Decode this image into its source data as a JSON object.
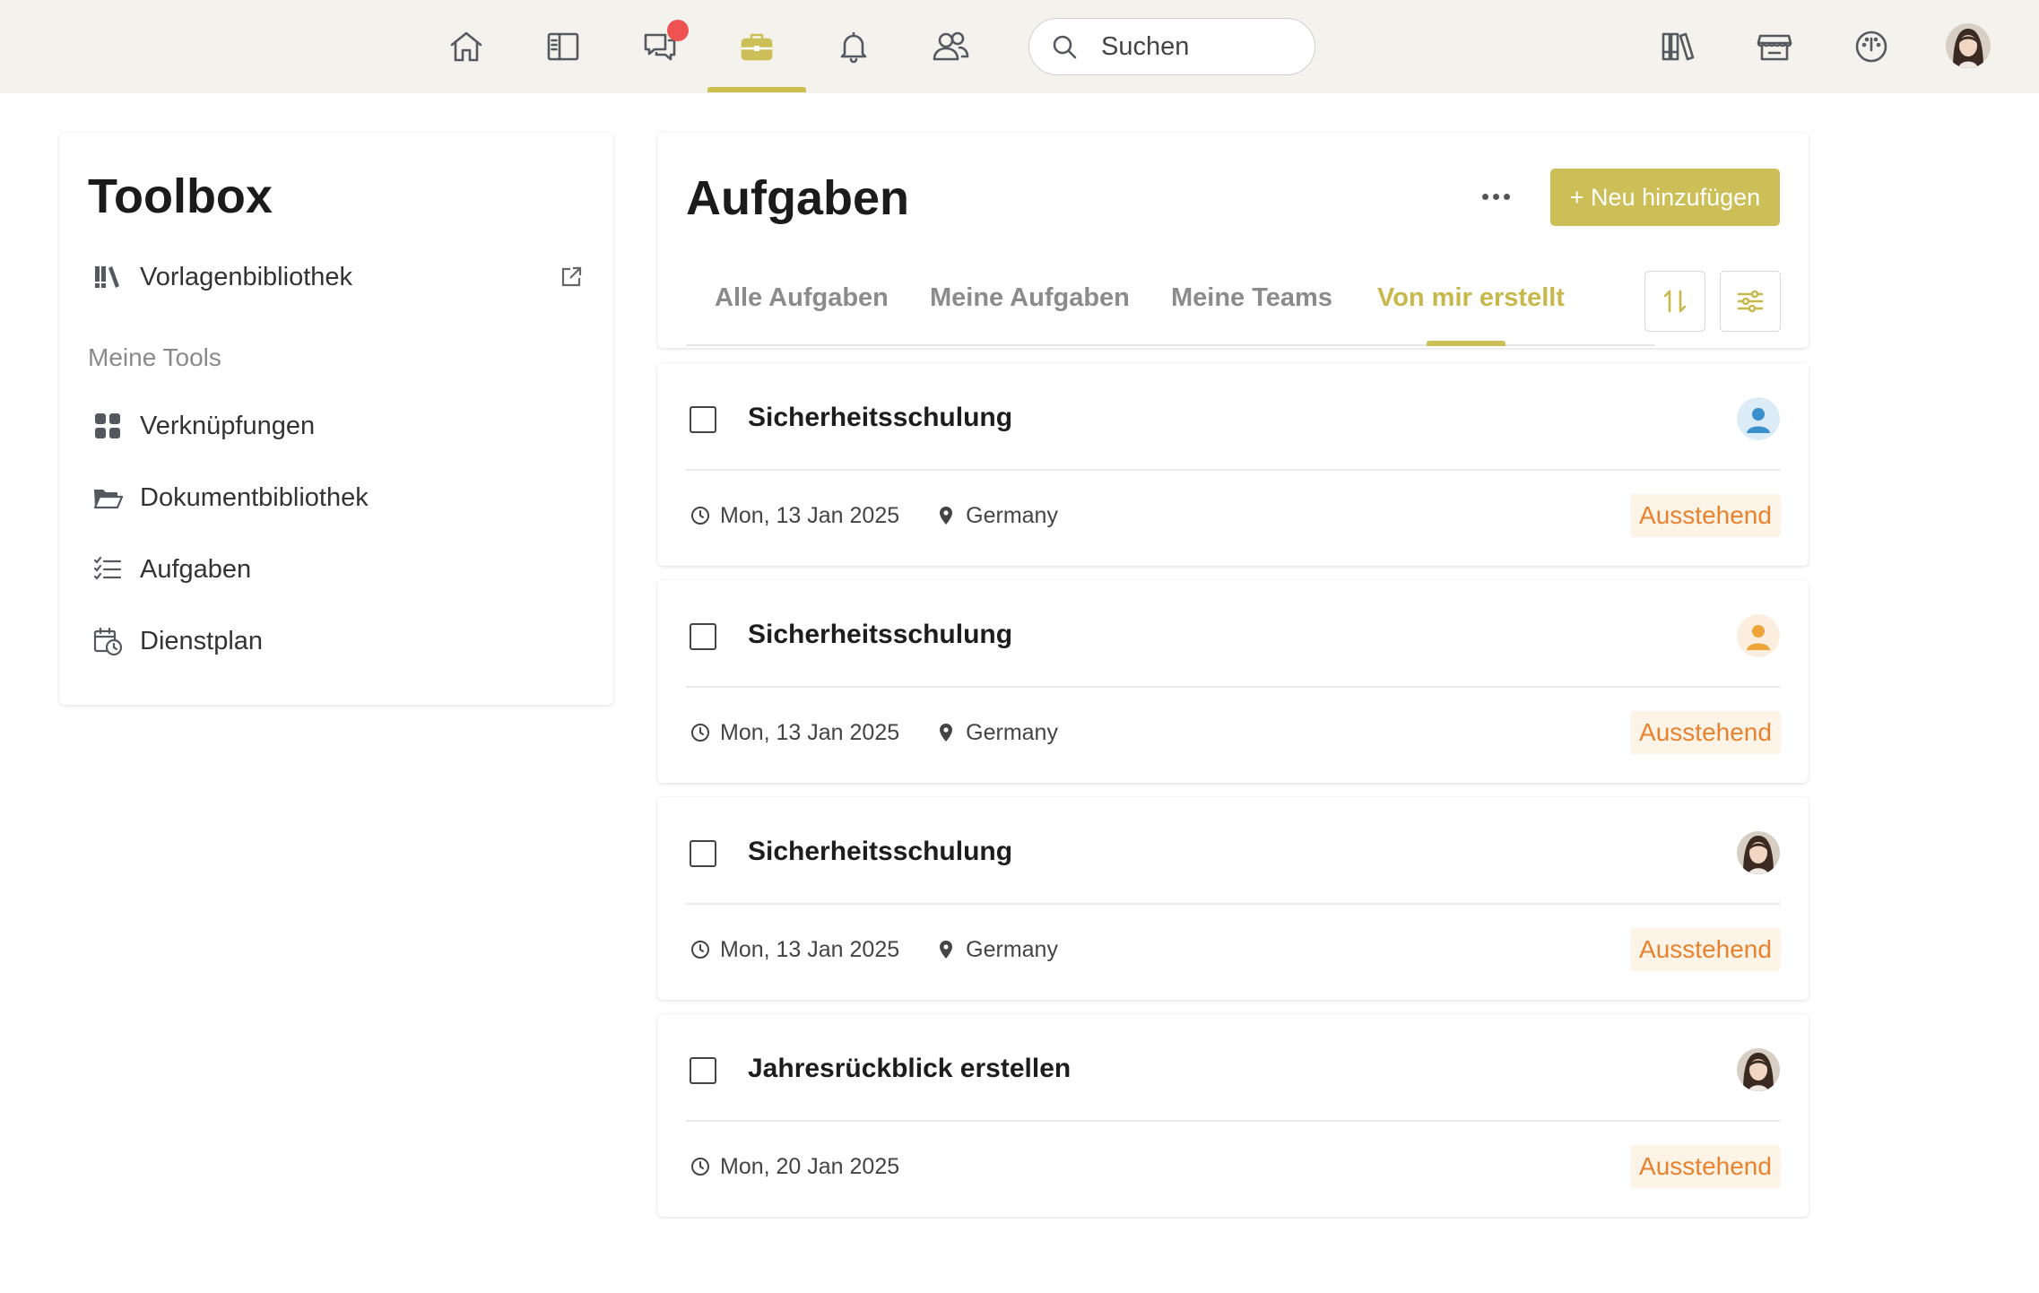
{
  "topnav": {
    "icons": [
      "home-icon",
      "sidebar-panel-icon",
      "chat-icon",
      "toolbox-icon",
      "bell-icon",
      "users-icon",
      "library-icon",
      "store-icon",
      "dashboard-icon"
    ],
    "active": "toolbox-icon",
    "has_chat_notification": true,
    "search_placeholder": "Suchen"
  },
  "sidebar": {
    "title": "Toolbox",
    "library_item": "Vorlagenbibliothek",
    "section_title": "Meine Tools",
    "items": [
      {
        "label": "Verknüpfungen",
        "icon": "grid-icon"
      },
      {
        "label": "Dokumentbibliothek",
        "icon": "folder-icon"
      },
      {
        "label": "Aufgaben",
        "icon": "checklist-icon"
      },
      {
        "label": "Dienstplan",
        "icon": "calendar-clock-icon"
      }
    ]
  },
  "main": {
    "title": "Aufgaben",
    "add_button": "+ Neu hinzufügen",
    "tabs": [
      "Alle Aufgaben",
      "Meine Aufgaben",
      "Meine Teams",
      "Von mir erstellt"
    ],
    "active_tab": 3
  },
  "tasks": [
    {
      "title": "Sicherheitsschulung",
      "date": "Mon, 13 Jan 2025",
      "location": "Germany",
      "status": "Ausstehend",
      "assignee": "blue-placeholder"
    },
    {
      "title": "Sicherheitsschulung",
      "date": "Mon, 13 Jan 2025",
      "location": "Germany",
      "status": "Ausstehend",
      "assignee": "orange-placeholder"
    },
    {
      "title": "Sicherheitsschulung",
      "date": "Mon, 13 Jan 2025",
      "location": "Germany",
      "status": "Ausstehend",
      "assignee": "photo"
    },
    {
      "title": "Jahresrückblick erstellen",
      "date": "Mon, 20 Jan 2025",
      "location": "",
      "status": "Ausstehend",
      "assignee": "photo"
    }
  ],
  "colors": {
    "accent": "#cdbf57",
    "status_pending_text": "#e9822e",
    "status_pending_bg": "#fdf3e6",
    "notification": "#ee5352",
    "topbar_bg": "#f4f2ec"
  }
}
